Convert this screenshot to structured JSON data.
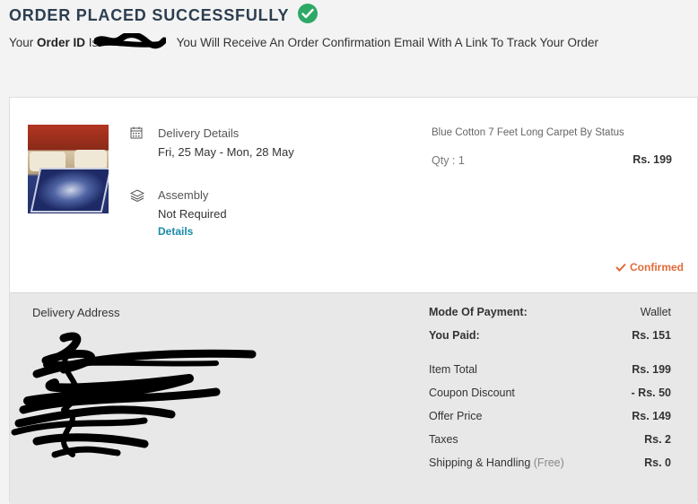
{
  "header": {
    "title": "ORDER PLACED SUCCESSFULLY",
    "line_prefix": "Your ",
    "order_id_label": "Order ID",
    "order_id_is": " Is ",
    "line_suffix": " You Will Receive An Order Confirmation Email With A Link To Track Your Order"
  },
  "item": {
    "delivery_label": "Delivery Details",
    "delivery_value": "Fri, 25 May - Mon, 28 May",
    "assembly_label": "Assembly",
    "assembly_value": "Not Required",
    "details_link": "Details",
    "product_name": "Blue Cotton 7 Feet Long Carpet By Status",
    "qty": "Qty : 1",
    "price": "Rs. 199",
    "status": "Confirmed"
  },
  "address": {
    "label": "Delivery Address"
  },
  "payment": {
    "mode_label": "Mode Of Payment:",
    "mode_value": "Wallet",
    "paid_label": "You Paid:",
    "paid_value": "Rs. 151",
    "item_total_label": "Item Total",
    "item_total_value": "Rs. 199",
    "coupon_label": "Coupon Discount",
    "coupon_value": "- Rs. 50",
    "offer_label": "Offer Price",
    "offer_value": "Rs. 149",
    "taxes_label": "Taxes",
    "taxes_value": "Rs. 2",
    "shipping_label": "Shipping & Handling",
    "shipping_note": "(Free)",
    "shipping_value": "Rs. 0"
  },
  "colors": {
    "success": "#2ea866",
    "link": "#1b8aa8",
    "confirmed": "#e26a3a",
    "coupon": "#7a9a2a"
  }
}
